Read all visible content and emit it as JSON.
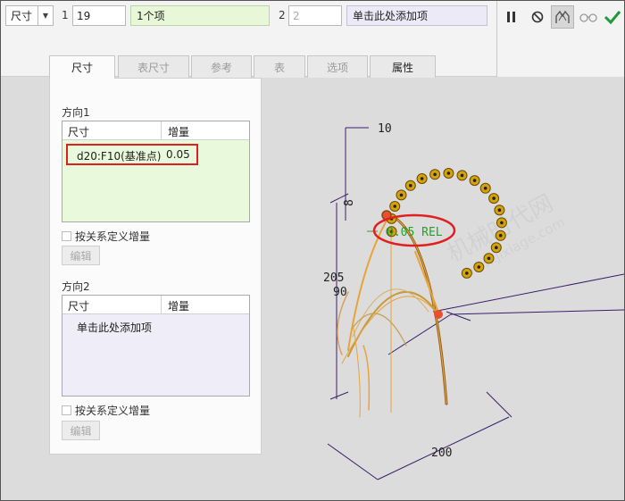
{
  "toolbar": {
    "mode_dropdown": "尺寸",
    "dir1_label": "1",
    "dir1_count": "19",
    "dir1_collector": "1个项",
    "dir2_label": "2",
    "dir2_count": "2",
    "dir2_collector": "单击此处添加项",
    "icons": [
      "pause-icon",
      "stop-icon",
      "preview-icon",
      "glasses-icon",
      "checkmark-icon"
    ]
  },
  "tabs": [
    {
      "label": "尺寸",
      "active": true
    },
    {
      "label": "表尺寸"
    },
    {
      "label": "参考"
    },
    {
      "label": "表"
    },
    {
      "label": "选项"
    },
    {
      "label": "属性"
    }
  ],
  "direction1": {
    "title": "方向1",
    "col_dim": "尺寸",
    "col_inc": "增量",
    "rows": [
      {
        "dim": "d20:F10(基准点)",
        "inc": "0.05"
      }
    ],
    "checkbox_label": "按关系定义增量",
    "edit_label": "编辑"
  },
  "direction2": {
    "title": "方向2",
    "col_dim": "尺寸",
    "col_inc": "增量",
    "placeholder": "单击此处添加项",
    "checkbox_label": "按关系定义增量",
    "edit_label": "编辑"
  },
  "graphics": {
    "dim_10": "10",
    "dim_8": "8",
    "dim_205": "205",
    "dim_90": "90",
    "dim_200": "200",
    "increment_label": "0.05 REL",
    "watermark": "机械时代网",
    "watermark_url": "www.jixiage.com",
    "highlight_color": "#e02020",
    "pattern_color": "#d4a20a"
  }
}
